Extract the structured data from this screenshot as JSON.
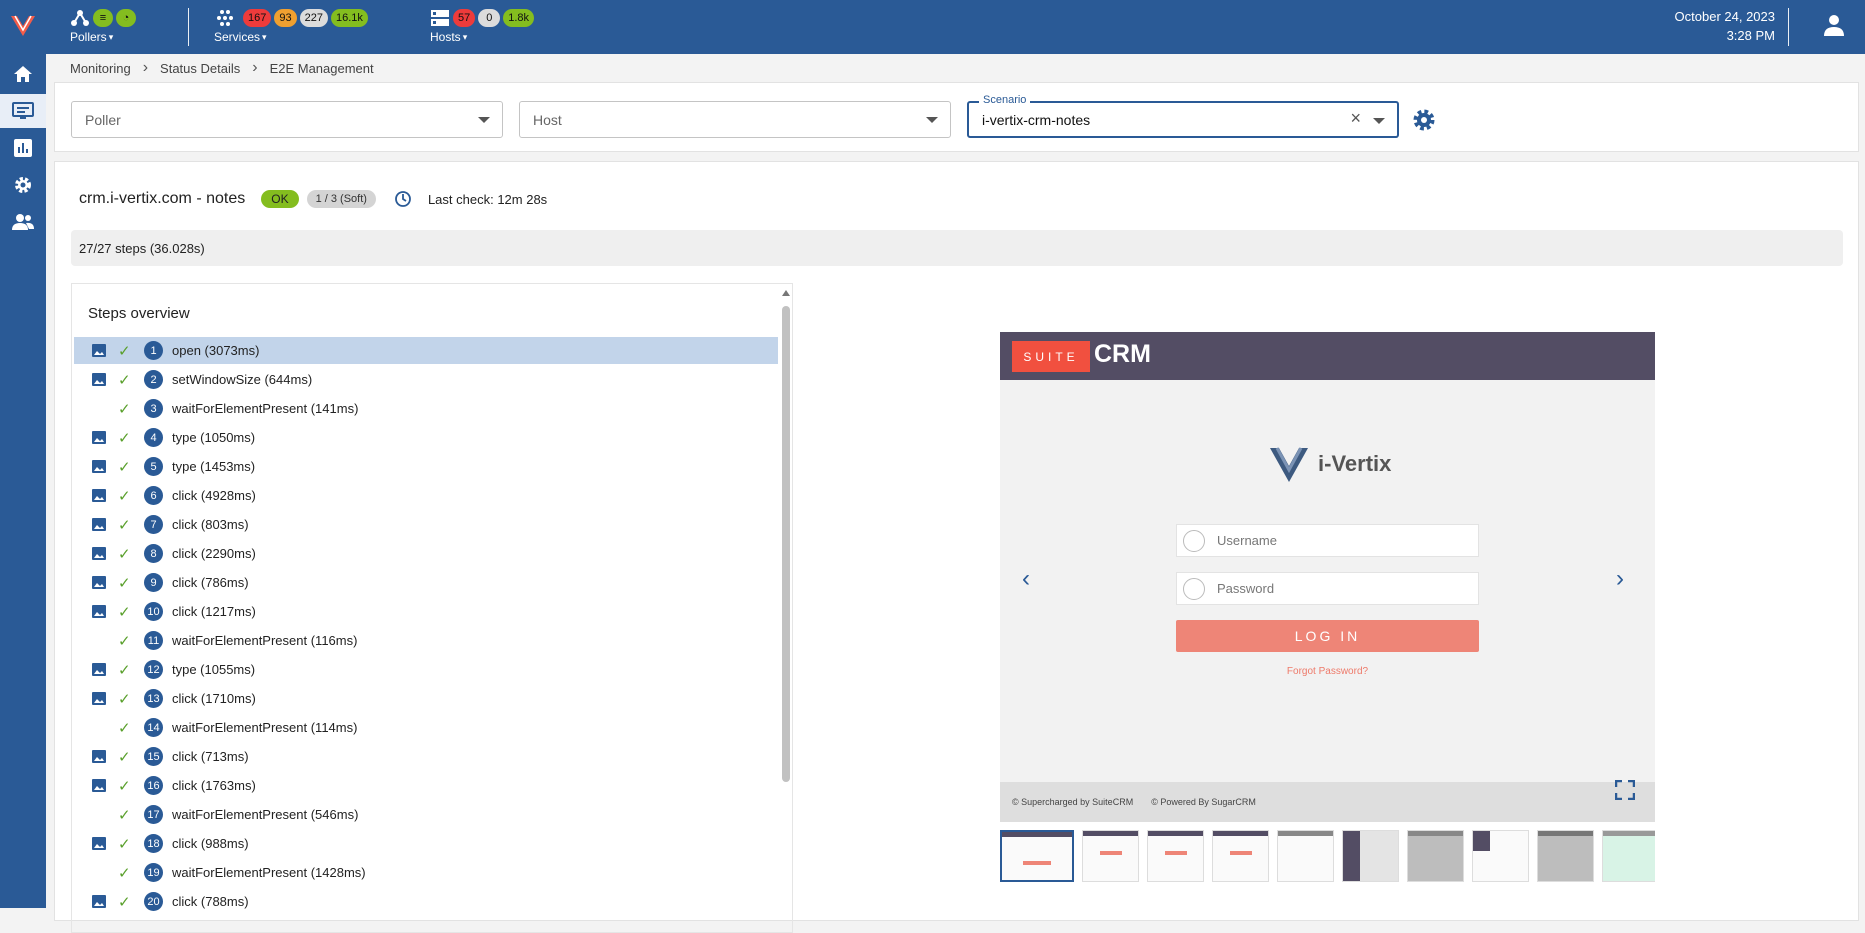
{
  "topbar": {
    "pollers": {
      "label": "Pollers"
    },
    "services": {
      "label": "Services",
      "critical": "167",
      "warning": "93",
      "unknown": "227",
      "ok": "16.1k"
    },
    "hosts": {
      "label": "Hosts",
      "down": "57",
      "unreachable": "0",
      "up": "1.8k"
    },
    "date": "October 24, 2023",
    "time": "3:28 PM",
    "colors": {
      "bg": "#2a5a96",
      "critical": "#ed3b3b",
      "warning": "#f0a030",
      "unknown": "#dcdcdc",
      "ok": "#84bd1f"
    }
  },
  "sidebar": {
    "items": [
      {
        "icon": "home-icon"
      },
      {
        "icon": "monitoring-icon",
        "active": true
      },
      {
        "icon": "chart-icon"
      },
      {
        "icon": "gear-icon"
      },
      {
        "icon": "users-icon"
      }
    ]
  },
  "breadcrumb": [
    "Monitoring",
    "Status Details",
    "E2E Management"
  ],
  "filters": {
    "poller_placeholder": "Poller",
    "host_placeholder": "Host",
    "scenario_legend": "Scenario",
    "scenario_value": "i-vertix-crm-notes"
  },
  "scenario": {
    "host": "crm.i-vertix.com - notes",
    "status": "OK",
    "attempt": "1 / 3 (Soft)",
    "last_check": "Last check: 12m 28s",
    "steps_summary": "27/27 steps (36.028s)"
  },
  "steps_overview": {
    "title": "Steps overview",
    "steps": [
      {
        "n": "1",
        "label": "open (3073ms)",
        "img": true
      },
      {
        "n": "2",
        "label": "setWindowSize (644ms)",
        "img": true
      },
      {
        "n": "3",
        "label": "waitForElementPresent (141ms)",
        "img": false
      },
      {
        "n": "4",
        "label": "type (1050ms)",
        "img": true
      },
      {
        "n": "5",
        "label": "type (1453ms)",
        "img": true
      },
      {
        "n": "6",
        "label": "click (4928ms)",
        "img": true
      },
      {
        "n": "7",
        "label": "click (803ms)",
        "img": true
      },
      {
        "n": "8",
        "label": "click (2290ms)",
        "img": true
      },
      {
        "n": "9",
        "label": "click (786ms)",
        "img": true
      },
      {
        "n": "10",
        "label": "click (1217ms)",
        "img": true
      },
      {
        "n": "11",
        "label": "waitForElementPresent (116ms)",
        "img": false
      },
      {
        "n": "12",
        "label": "type (1055ms)",
        "img": true
      },
      {
        "n": "13",
        "label": "click (1710ms)",
        "img": true
      },
      {
        "n": "14",
        "label": "waitForElementPresent (114ms)",
        "img": false
      },
      {
        "n": "15",
        "label": "click (713ms)",
        "img": true
      },
      {
        "n": "16",
        "label": "click (1763ms)",
        "img": true
      },
      {
        "n": "17",
        "label": "waitForElementPresent (546ms)",
        "img": false
      },
      {
        "n": "18",
        "label": "click (988ms)",
        "img": true
      },
      {
        "n": "19",
        "label": "waitForElementPresent (1428ms)",
        "img": false
      },
      {
        "n": "20",
        "label": "click (788ms)",
        "img": true
      }
    ]
  },
  "screenshot": {
    "suite": "SUITE",
    "crm": "CRM",
    "brand": "i-Vertix",
    "username_placeholder": "Username",
    "password_placeholder": "Password",
    "login": "LOG IN",
    "forgot": "Forgot Password?",
    "footer_left": "© Supercharged by SuiteCRM",
    "footer_right": "© Powered By SugarCRM"
  }
}
